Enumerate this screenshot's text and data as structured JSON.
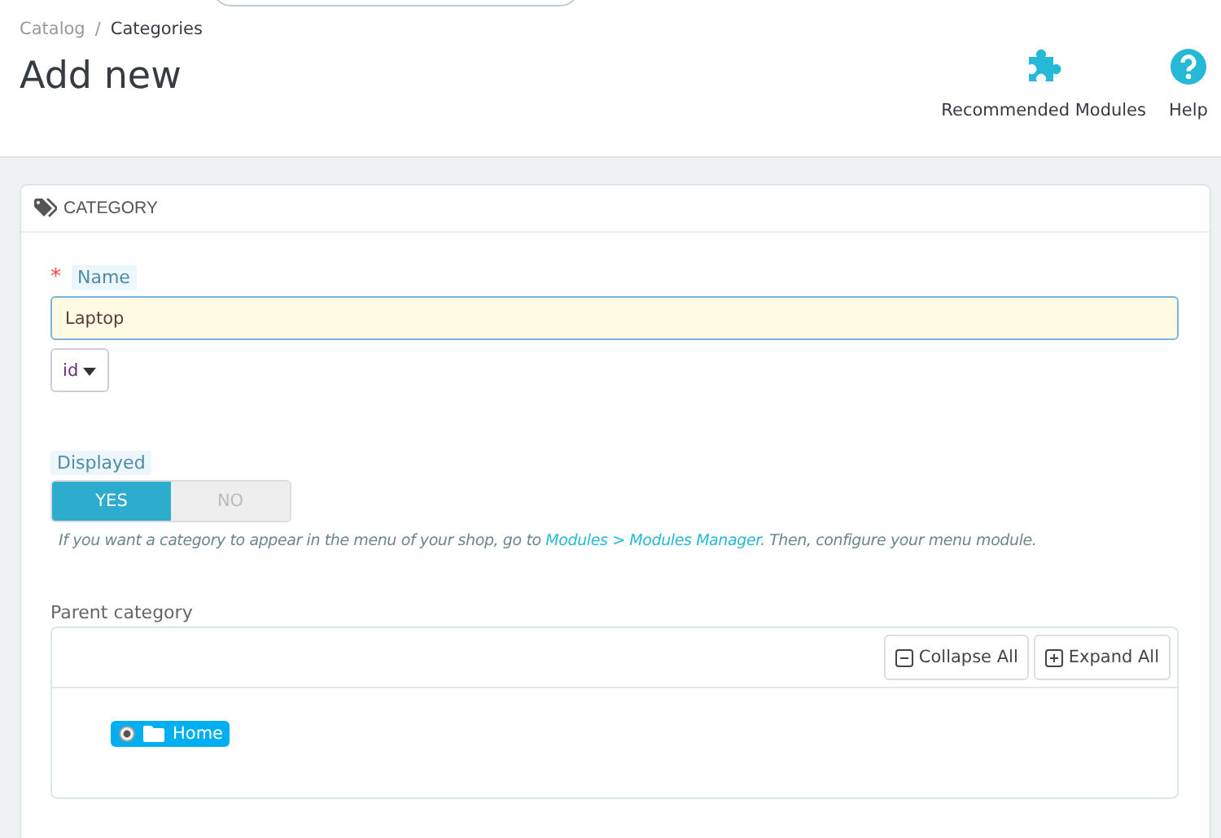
{
  "breadcrumb": [
    {
      "label": "Catalog"
    },
    {
      "label": "Categories"
    }
  ],
  "breadcrumb_separator": "/",
  "page_title": "Add new",
  "toolbar": [
    {
      "label": "Recommended Modules",
      "kind": "puzzle"
    },
    {
      "label": "Help",
      "kind": "help"
    }
  ],
  "panel": {
    "title": "CATEGORY",
    "name_field": {
      "label": "Name",
      "required_mark": "*",
      "value": "Laptop",
      "language": "id"
    },
    "displayed": {
      "label": "Displayed",
      "options": [
        {
          "label": "YES",
          "selected": true
        },
        {
          "label": "NO",
          "selected": false
        }
      ],
      "help": "If you want a category to appear in the menu of your shop, go to ",
      "help_link": "Modules > Modules Manager",
      "help_end": ". Then, configure your menu module."
    },
    "parent_category": {
      "label": "Parent category",
      "buttons": [
        {
          "label": "Collapse All",
          "kind": "collapse"
        },
        {
          "label": "Expand All",
          "kind": "expand"
        }
      ],
      "tree": [
        {
          "label": "Home",
          "selected": true
        }
      ]
    }
  }
}
